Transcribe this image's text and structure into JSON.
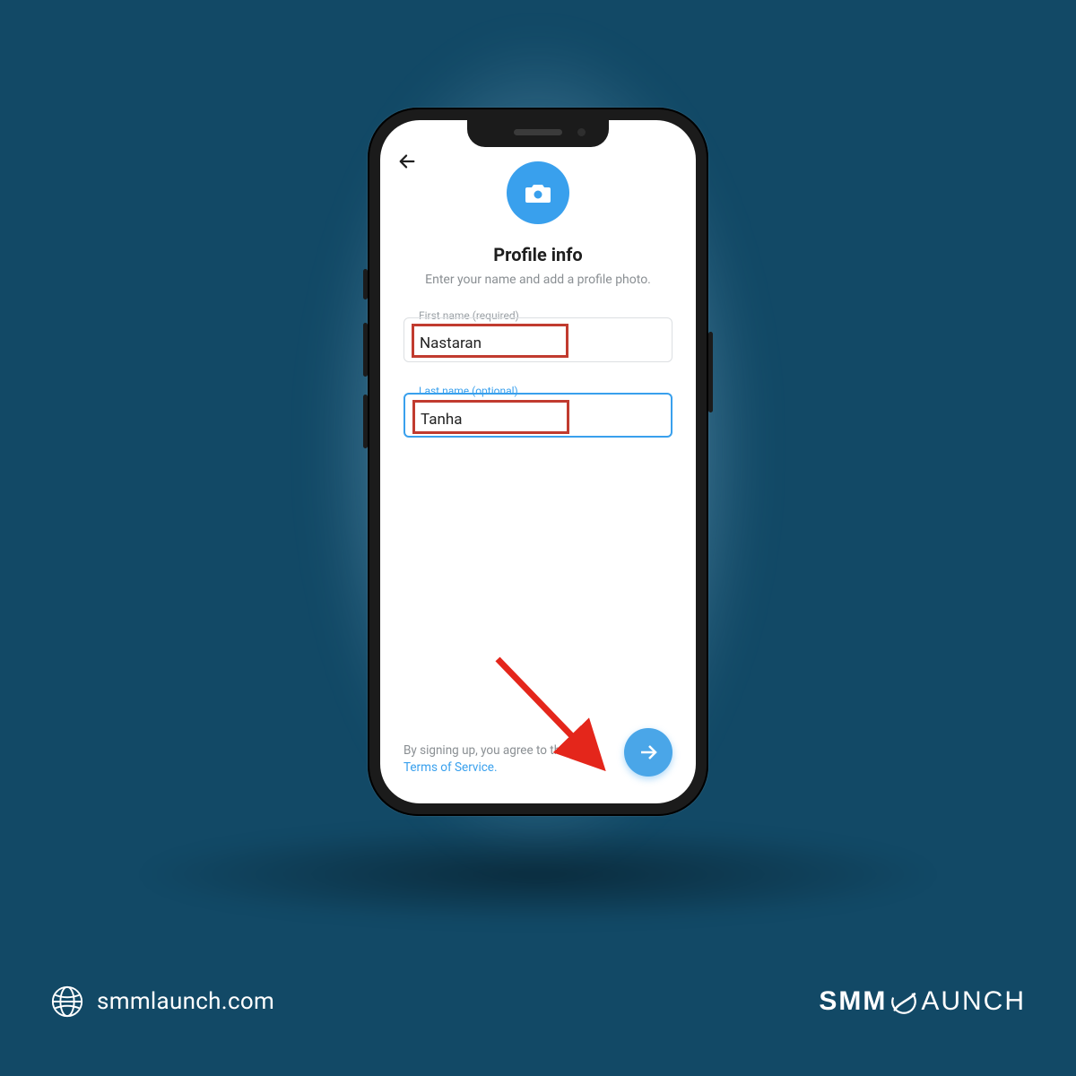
{
  "screen": {
    "title": "Profile info",
    "subtitle": "Enter your name and add a profile photo.",
    "first_name": {
      "label": "First name (required)",
      "value": "Nastaran"
    },
    "last_name": {
      "label": "Last name (optional)",
      "value": "Tanha"
    },
    "terms_pre": "By signing up, you agree to the ",
    "terms_link": "Terms of Service."
  },
  "footer": {
    "site_url": "smmlaunch.com",
    "brand_left": "SMM",
    "brand_right": "AUNCH"
  },
  "colors": {
    "accent": "#39a0ed",
    "background": "#124966",
    "highlight_box": "#c13b2f"
  }
}
